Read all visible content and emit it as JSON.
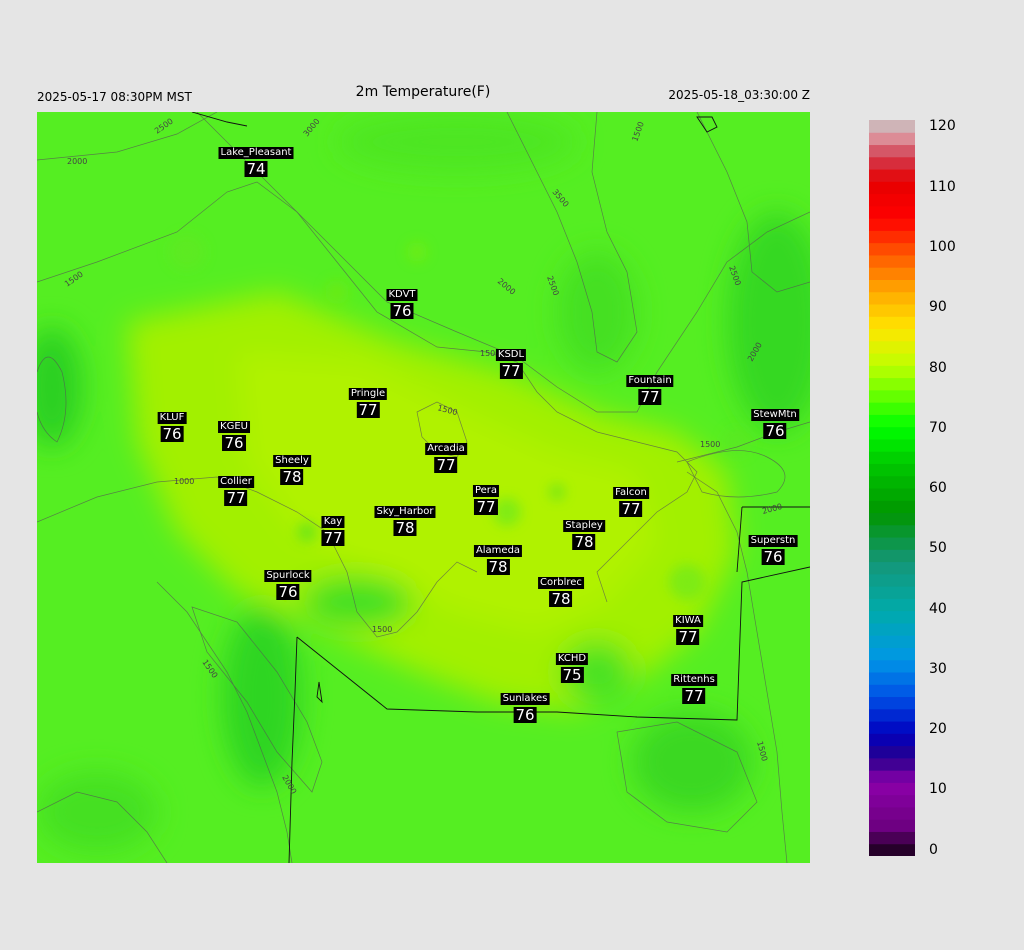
{
  "header": {
    "title": "2m Temperature(F)",
    "local_time": "2025-05-17 08:30PM MST",
    "valid_time": "2025-05-18_03:30:00 Z"
  },
  "stations": [
    {
      "name": "Lake_Pleasant",
      "value": "74"
    },
    {
      "name": "KDVT",
      "value": "76"
    },
    {
      "name": "KSDL",
      "value": "77"
    },
    {
      "name": "Pringle",
      "value": "77"
    },
    {
      "name": "Fountain",
      "value": "77"
    },
    {
      "name": "KLUF",
      "value": "76"
    },
    {
      "name": "KGEU",
      "value": "76"
    },
    {
      "name": "StewMtn",
      "value": "76"
    },
    {
      "name": "Arcadia",
      "value": "77"
    },
    {
      "name": "Sheely",
      "value": "78"
    },
    {
      "name": "Collier",
      "value": "77"
    },
    {
      "name": "Pera",
      "value": "77"
    },
    {
      "name": "Falcon",
      "value": "77"
    },
    {
      "name": "Sky_Harbor",
      "value": "78"
    },
    {
      "name": "Kay",
      "value": "77"
    },
    {
      "name": "Stapley",
      "value": "78"
    },
    {
      "name": "Superstn",
      "value": "76"
    },
    {
      "name": "Alameda",
      "value": "78"
    },
    {
      "name": "Spurlock",
      "value": "76"
    },
    {
      "name": "Corblrec",
      "value": "78"
    },
    {
      "name": "KIWA",
      "value": "77"
    },
    {
      "name": "KCHD",
      "value": "75"
    },
    {
      "name": "Rittenhs",
      "value": "77"
    },
    {
      "name": "Sunlakes",
      "value": "76"
    }
  ],
  "contour_labels": [
    "2500",
    "2000",
    "3000",
    "3500",
    "1500",
    "2500",
    "2000",
    "1500",
    "2500",
    "2000",
    "1500",
    "1500",
    "1000",
    "2000",
    "1500",
    "1500",
    "2000",
    "1500",
    "1500"
  ],
  "colorbar": {
    "labels": [
      "120",
      "110",
      "100",
      "90",
      "80",
      "70",
      "60",
      "50",
      "40",
      "30",
      "20",
      "10",
      "0"
    ],
    "min": 0,
    "max": 120
  },
  "colors": {
    "background": "#e5e5e5",
    "field_base": "#55ee22",
    "field_warm": "#aaf000",
    "field_cool": "#33d822"
  }
}
